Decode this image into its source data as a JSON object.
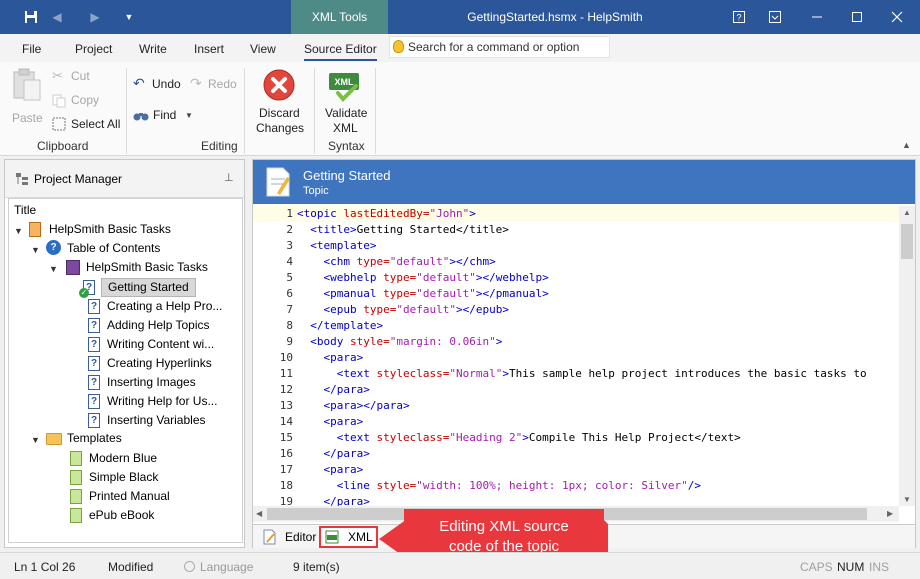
{
  "titlebar": {
    "contextual_tab": "XML Tools",
    "title": "GettingStarted.hsmx - HelpSmith"
  },
  "ribbon_tabs": [
    "File",
    "Project",
    "Write",
    "Insert",
    "View",
    "Source Editor"
  ],
  "command_search": {
    "placeholder": "Search for a command or option"
  },
  "ribbon": {
    "paste": "Paste",
    "cut": "Cut",
    "copy": "Copy",
    "select_all": "Select All",
    "clipboard_group": "Clipboard",
    "undo": "Undo",
    "redo": "Redo",
    "find": "Find",
    "editing_group": "Editing",
    "discard_line1": "Discard",
    "discard_line2": "Changes",
    "validate_line1": "Validate",
    "validate_line2": "XML",
    "syntax_group": "Syntax"
  },
  "project_manager": {
    "title": "Project Manager",
    "tree_header": "Title",
    "root": "HelpSmith Basic Tasks",
    "toc": "Table of Contents",
    "book": "HelpSmith Basic Tasks",
    "topics": [
      "Getting Started",
      "Creating a Help Pro...",
      "Adding Help Topics",
      "Writing Content wi...",
      "Creating Hyperlinks",
      "Inserting Images",
      "Writing Help for Us...",
      "Inserting Variables"
    ],
    "templates_folder": "Templates",
    "templates": [
      "Modern Blue",
      "Simple Black",
      "Printed Manual",
      "ePub eBook"
    ]
  },
  "editor": {
    "topic_title": "Getting Started",
    "topic_subtitle": "Topic",
    "tab_editor": "Editor",
    "tab_xml": "XML"
  },
  "code_lines": [
    {
      "n": "1",
      "i": "",
      "t": "<topic ",
      "a": "lastEditedBy=",
      "v": "\"John\"",
      "e": ">",
      "x": ""
    },
    {
      "n": "2",
      "i": "  ",
      "t": "<title>",
      "a": "",
      "v": "",
      "e": "",
      "x": "Getting Started</title>"
    },
    {
      "n": "3",
      "i": "  ",
      "t": "<template>",
      "a": "",
      "v": "",
      "e": "",
      "x": ""
    },
    {
      "n": "4",
      "i": "    ",
      "t": "<chm ",
      "a": "type=",
      "v": "\"default\"",
      "e": "></chm>",
      "x": ""
    },
    {
      "n": "5",
      "i": "    ",
      "t": "<webhelp ",
      "a": "type=",
      "v": "\"default\"",
      "e": "></webhelp>",
      "x": ""
    },
    {
      "n": "6",
      "i": "    ",
      "t": "<pmanual ",
      "a": "type=",
      "v": "\"default\"",
      "e": "></pmanual>",
      "x": ""
    },
    {
      "n": "7",
      "i": "    ",
      "t": "<epub ",
      "a": "type=",
      "v": "\"default\"",
      "e": "></epub>",
      "x": ""
    },
    {
      "n": "8",
      "i": "  ",
      "t": "</template>",
      "a": "",
      "v": "",
      "e": "",
      "x": ""
    },
    {
      "n": "9",
      "i": "  ",
      "t": "<body ",
      "a": "style=",
      "v": "\"margin: 0.06in\"",
      "e": ">",
      "x": ""
    },
    {
      "n": "10",
      "i": "    ",
      "t": "<para>",
      "a": "",
      "v": "",
      "e": "",
      "x": ""
    },
    {
      "n": "11",
      "i": "      ",
      "t": "<text ",
      "a": "styleclass=",
      "v": "\"Normal\"",
      "e": ">",
      "x": "This sample help project introduces the basic tasks to"
    },
    {
      "n": "12",
      "i": "    ",
      "t": "</para>",
      "a": "",
      "v": "",
      "e": "",
      "x": ""
    },
    {
      "n": "13",
      "i": "    ",
      "t": "<para></para>",
      "a": "",
      "v": "",
      "e": "",
      "x": ""
    },
    {
      "n": "14",
      "i": "    ",
      "t": "<para>",
      "a": "",
      "v": "",
      "e": "",
      "x": ""
    },
    {
      "n": "15",
      "i": "      ",
      "t": "<text ",
      "a": "styleclass=",
      "v": "\"Heading 2\"",
      "e": ">",
      "x": "Compile This Help Project</text>"
    },
    {
      "n": "16",
      "i": "    ",
      "t": "</para>",
      "a": "",
      "v": "",
      "e": "",
      "x": ""
    },
    {
      "n": "17",
      "i": "    ",
      "t": "<para>",
      "a": "",
      "v": "",
      "e": "",
      "x": ""
    },
    {
      "n": "18",
      "i": "      ",
      "t": "<line ",
      "a": "style=",
      "v": "\"width: 100%; height: 1px; color: Silver\"",
      "e": "/>",
      "x": ""
    },
    {
      "n": "19",
      "i": "    ",
      "t": "</para>",
      "a": "",
      "v": "",
      "e": "",
      "x": ""
    }
  ],
  "callout": {
    "line1": "Editing XML source",
    "line2": "code of the topic"
  },
  "status": {
    "position": "Ln 1 Col 26",
    "state": "Modified",
    "language": "Language",
    "items": "9 item(s)",
    "caps": "CAPS",
    "num": "NUM",
    "ins": "INS"
  },
  "colors": {
    "accent": "#2b579a",
    "context_tab": "#4e8a86",
    "topic_header": "#3f74bf",
    "callout": "#e8383d"
  }
}
